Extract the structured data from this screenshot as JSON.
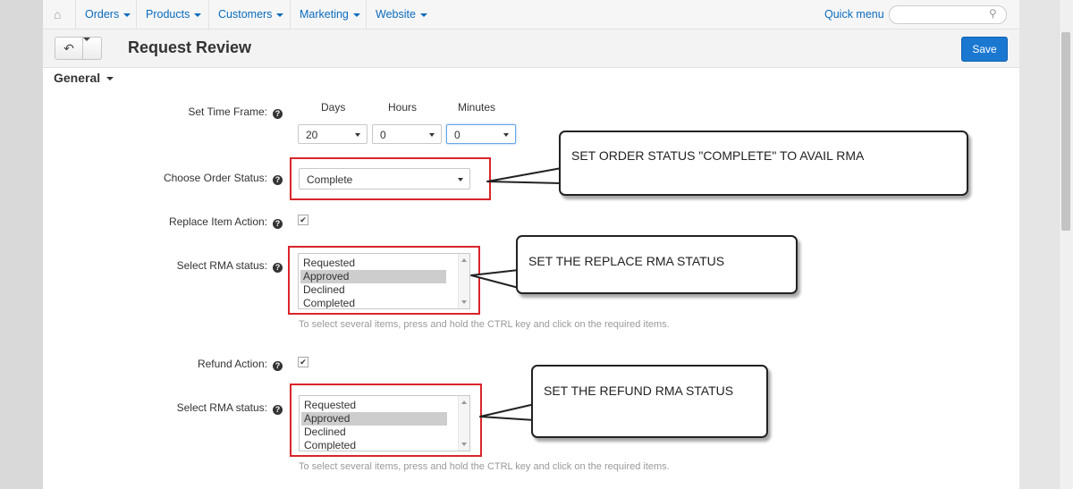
{
  "nav": {
    "items": [
      "Orders",
      "Products",
      "Customers",
      "Marketing",
      "Website"
    ],
    "quick_menu": "Quick menu",
    "search_placeholder": ""
  },
  "header": {
    "title": "Request Review",
    "save_label": "Save"
  },
  "section": {
    "title": "General"
  },
  "form": {
    "time_frame_label": "Set Time Frame:",
    "columns": [
      "Days",
      "Hours",
      "Minutes"
    ],
    "values": [
      "20",
      "0",
      "0"
    ],
    "order_status_label": "Choose Order Status:",
    "order_status_value": "Complete",
    "replace_label": "Replace Item Action:",
    "replace_checked": true,
    "rma_label_1": "Select RMA status:",
    "rma_options_1": [
      "Requested",
      "Approved",
      "Declined",
      "Completed"
    ],
    "rma_selected_1": "Approved",
    "hint_1": "To select several items, press and hold the CTRL key and click on the required items.",
    "refund_label": "Refund Action:",
    "refund_checked": true,
    "rma_label_2": "Select RMA status:",
    "rma_options_2": [
      "Requested",
      "Approved",
      "Declined",
      "Completed"
    ],
    "rma_selected_2": "Approved",
    "hint_2": "To select several items, press and hold the CTRL key and click on the required items."
  },
  "annotations": {
    "callout_1": "SET ORDER STATUS \"COMPLETE\" TO AVAIL RMA",
    "callout_2": "SET THE REPLACE RMA STATUS",
    "callout_3": "SET THE REFUND RMA STATUS",
    "highlight_color": "#d9252a"
  },
  "colors": {
    "accent": "#1b78d1",
    "link": "#0b6bbd"
  },
  "icons": [
    "home-icon",
    "back-arrow-icon",
    "chevron-down-icon",
    "search-icon",
    "help-icon",
    "checkbox-icon"
  ]
}
